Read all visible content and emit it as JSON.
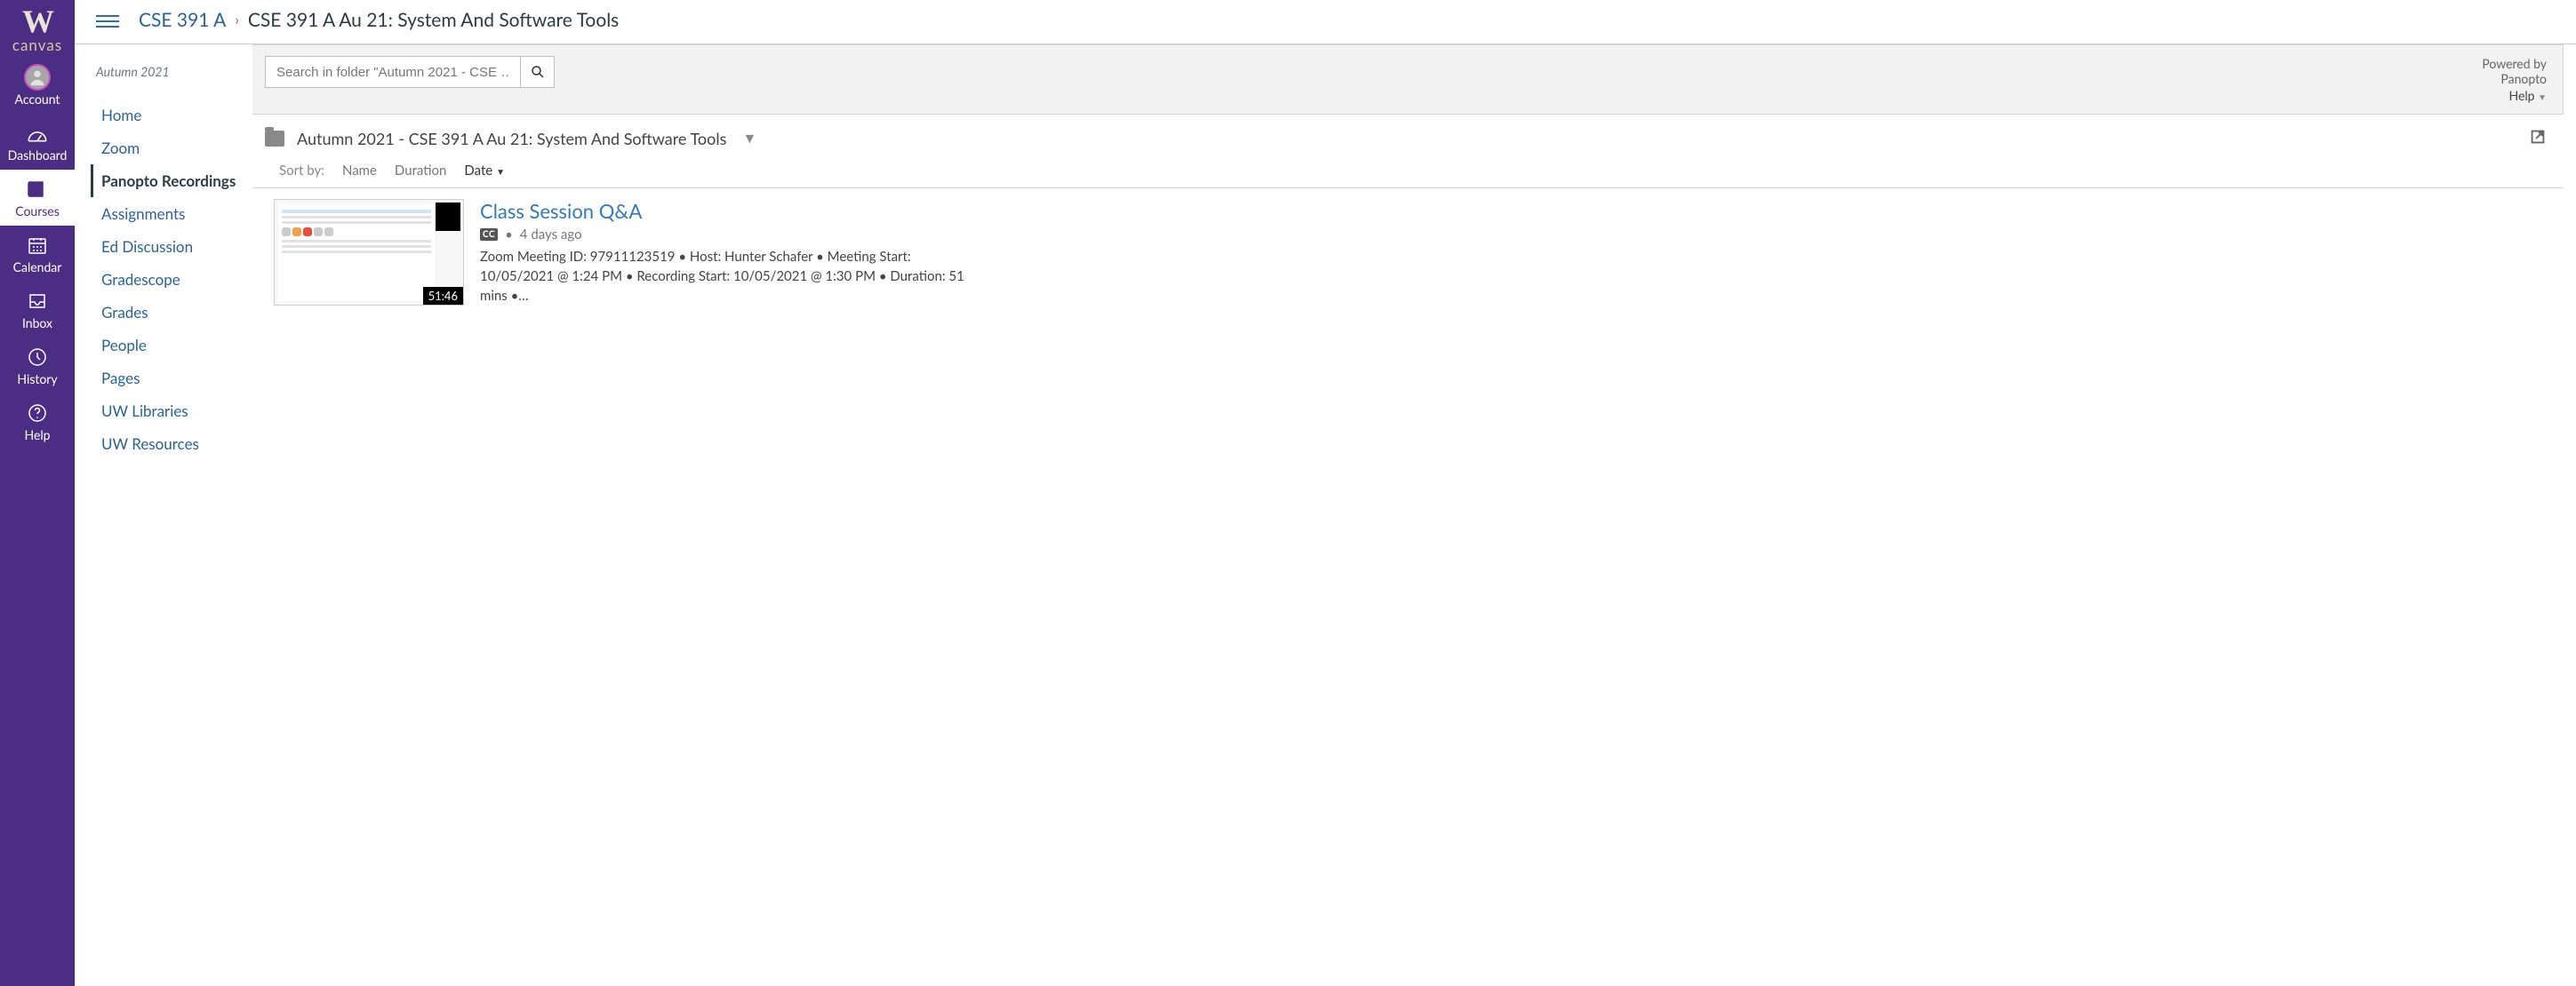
{
  "brand": {
    "logo_letter": "W",
    "product": "canvas"
  },
  "global_nav": [
    {
      "id": "account",
      "label": "Account"
    },
    {
      "id": "dashboard",
      "label": "Dashboard"
    },
    {
      "id": "courses",
      "label": "Courses"
    },
    {
      "id": "calendar",
      "label": "Calendar"
    },
    {
      "id": "inbox",
      "label": "Inbox"
    },
    {
      "id": "history",
      "label": "History"
    },
    {
      "id": "help",
      "label": "Help"
    }
  ],
  "breadcrumb": {
    "course_link": "CSE 391 A",
    "separator": "›",
    "page_title": "CSE 391 A Au 21: System And Software Tools"
  },
  "course_menu": {
    "term": "Autumn 2021",
    "items": [
      {
        "label": "Home"
      },
      {
        "label": "Zoom"
      },
      {
        "label": "Panopto Recordings",
        "active": true
      },
      {
        "label": "Assignments"
      },
      {
        "label": "Ed Discussion"
      },
      {
        "label": "Gradescope"
      },
      {
        "label": "Grades"
      },
      {
        "label": "People"
      },
      {
        "label": "Pages"
      },
      {
        "label": "UW Libraries"
      },
      {
        "label": "UW Resources"
      }
    ]
  },
  "panopto": {
    "search_placeholder": "Search in folder \"Autumn 2021 - CSE …",
    "powered_by": "Powered by",
    "brand": "Panopto",
    "help_label": "Help",
    "folder_name": "Autumn 2021 - CSE 391 A Au 21: System And Software Tools",
    "sort": {
      "label": "Sort by:",
      "options": [
        {
          "label": "Name"
        },
        {
          "label": "Duration"
        },
        {
          "label": "Date",
          "active": true
        }
      ]
    },
    "recordings": [
      {
        "title": "Class Session Q&A",
        "cc": "CC",
        "age": "4 days ago",
        "duration_stamp": "51:46",
        "details": "Zoom Meeting ID: 97911123519   • Host: Hunter Schafer   • Meeting Start: 10/05/2021 @ 1:24 PM   • Recording Start: 10/05/2021 @ 1:30 PM   • Duration: 51 mins   •…"
      }
    ]
  }
}
